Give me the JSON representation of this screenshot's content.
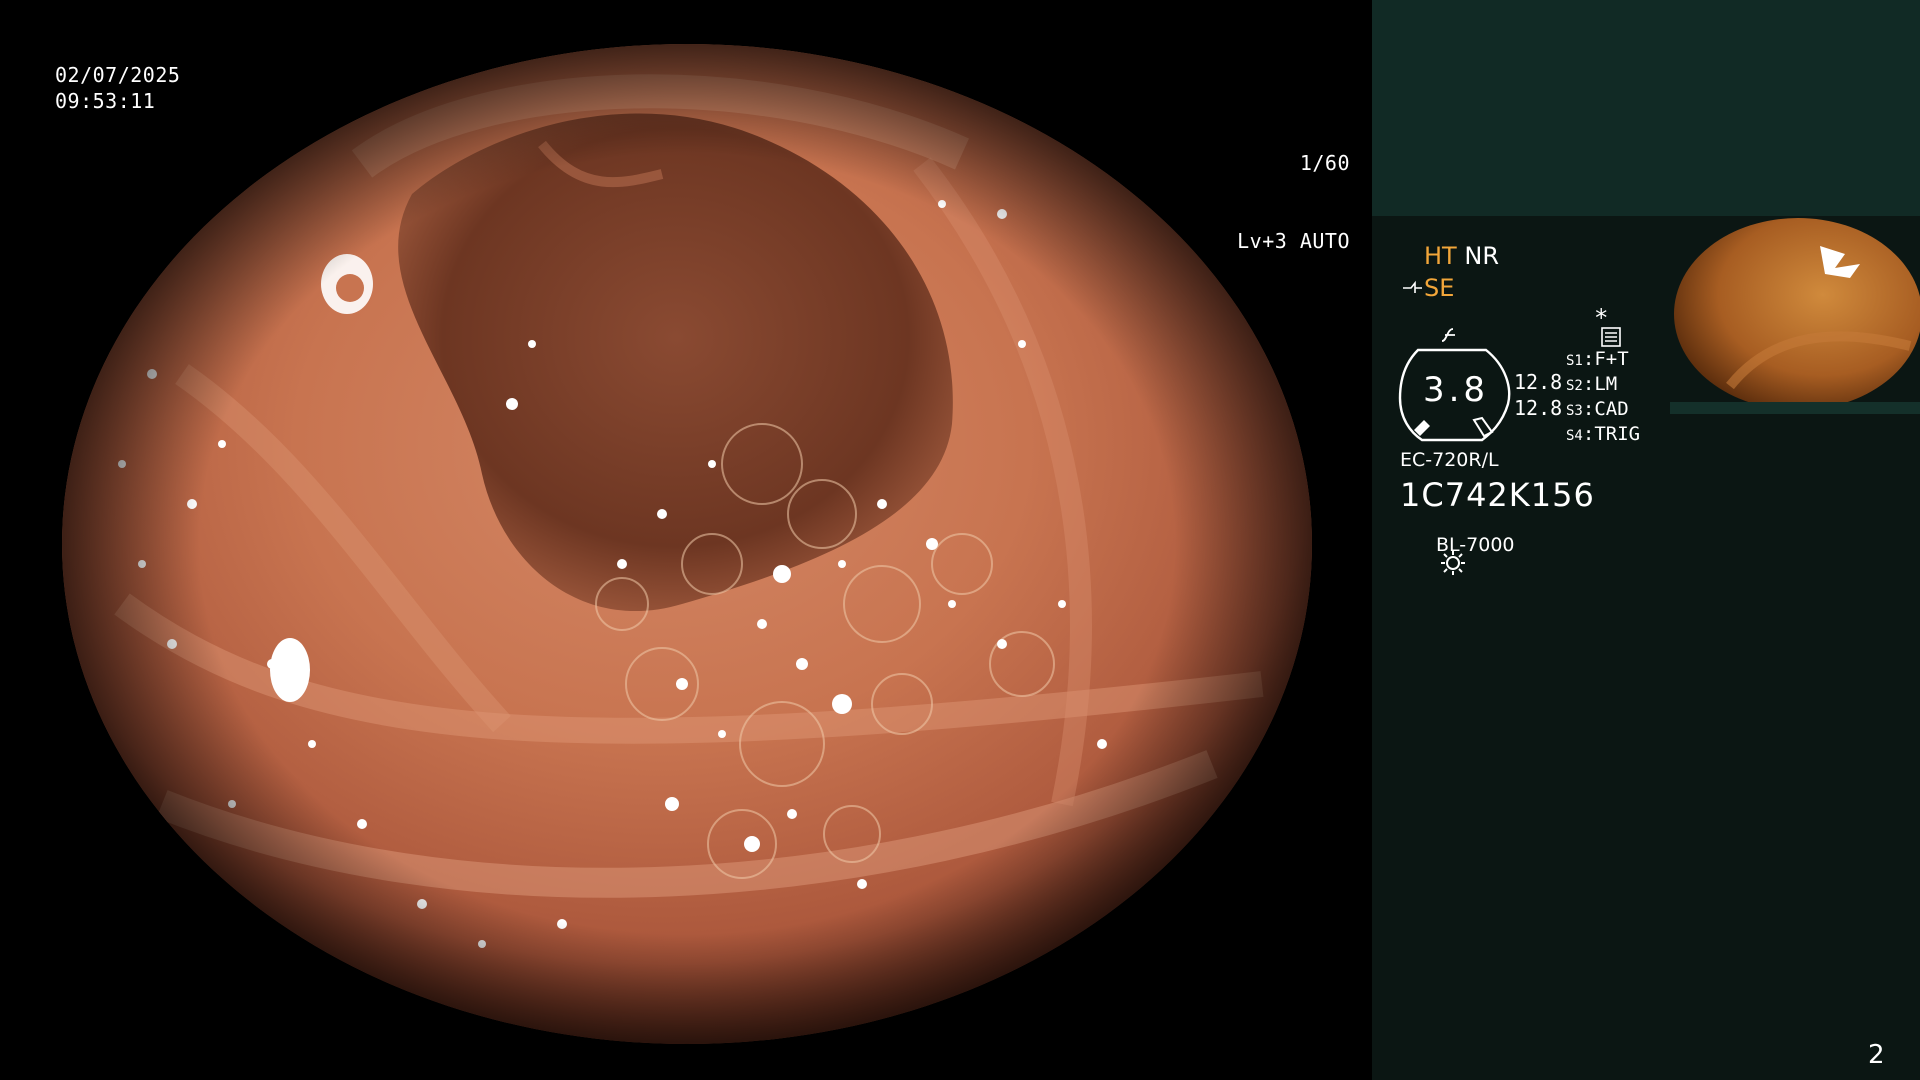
{
  "overlay": {
    "date": "02/07/2025",
    "time": "09:53:11",
    "shutter": "1/60",
    "iris": "Lv+3 AUTO"
  },
  "side_panel": {
    "mode_ht": "HT",
    "mode_nr": "NR",
    "mode_se": "SE",
    "star": "*",
    "zoom_value": "3.8",
    "values": [
      "12.8",
      "12.8"
    ],
    "slots": [
      {
        "key": "S1",
        "value": "F+T"
      },
      {
        "key": "S2",
        "value": "LM"
      },
      {
        "key": "S3",
        "value": "CAD"
      },
      {
        "key": "S4",
        "value": "TRIG"
      }
    ],
    "scope_model": "EC-720R/L",
    "serial": "1C742K156",
    "light_source": "BL-7000",
    "page_number": "2"
  },
  "colors": {
    "accent": "#f2a63a",
    "panel_bg": "#0b1613",
    "panel_top": "#112a25",
    "tissue": "#c8704f"
  },
  "icons": [
    "aperture-icon",
    "auto-iris-icon",
    "scope-tip-icon",
    "frequency-icon",
    "enhance-icon",
    "light-source-icon"
  ]
}
